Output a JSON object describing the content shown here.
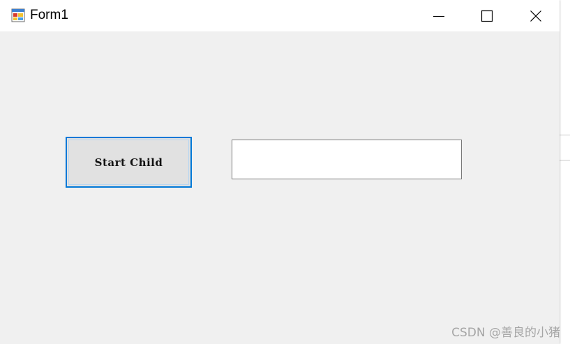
{
  "window": {
    "title": "Form1",
    "icon": "winforms-app-icon",
    "controls": {
      "minimize_icon": "minimize-icon",
      "maximize_icon": "maximize-icon",
      "close_icon": "close-icon"
    }
  },
  "form": {
    "start_button_label": "Start Child",
    "text_box_value": ""
  },
  "watermark": "CSDN @善良的小猪",
  "colors": {
    "accent": "#0078d7",
    "form_background": "#f0f0f0",
    "button_face": "#e1e1e1"
  }
}
